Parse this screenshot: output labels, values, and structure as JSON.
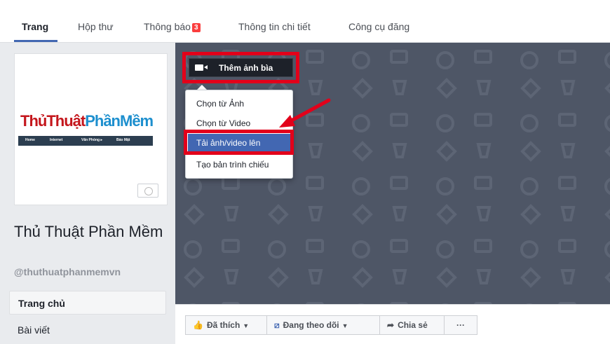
{
  "tabs": [
    {
      "label": "Trang"
    },
    {
      "label": "Hộp thư"
    },
    {
      "label": "Thông báo",
      "badge": "3"
    },
    {
      "label": "Thông tin chi tiết"
    },
    {
      "label": "Công cụ đăng"
    }
  ],
  "profile": {
    "logo_part1": "ThủThuật",
    "logo_part2": "PhầnMềm",
    "logo_menu": [
      "Home",
      "Internet",
      "Văn Phòng ▸",
      "Bảo Mật"
    ],
    "page_name": "Thủ Thuật Phần Mềm",
    "handle": "@thuthuatphanmemvn"
  },
  "sidebar": {
    "items": [
      {
        "label": "Trang chủ"
      },
      {
        "label": "Bài viết"
      }
    ]
  },
  "cover": {
    "add_cover_label": "Thêm ảnh bìa",
    "menu": [
      {
        "label": "Chọn từ Ảnh"
      },
      {
        "label": "Chọn từ Video"
      },
      {
        "label": "Tải ảnh/video lên"
      },
      {
        "label": "Tạo bản trình chiếu"
      }
    ]
  },
  "actions": {
    "liked": "Đã thích",
    "following": "Đang theo dõi",
    "share": "Chia sẻ",
    "more": "···"
  },
  "colors": {
    "accent": "#4267b2",
    "highlight_red": "#e2001a",
    "cover_bg": "#4e5666"
  }
}
